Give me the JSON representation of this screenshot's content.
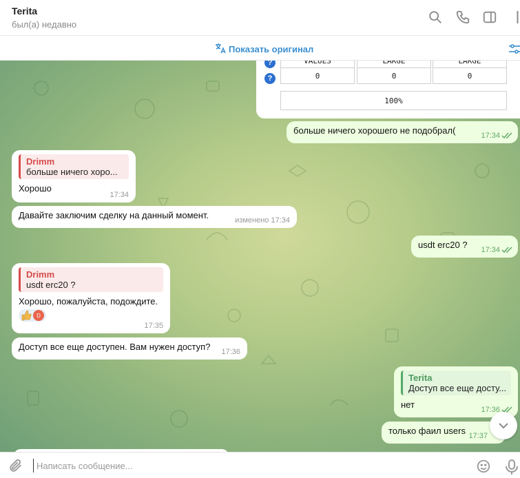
{
  "header": {
    "contact_name": "Terita",
    "status": "был(а) недавно",
    "icons": [
      "search-icon",
      "phone-icon",
      "sidebar-toggle-icon",
      "more-icon"
    ]
  },
  "translate_bar": {
    "label": "Показать оригинал",
    "icons": [
      "translate-icon",
      "filter-icon"
    ]
  },
  "table_card": {
    "row_values": [
      "0",
      "0",
      "0"
    ],
    "progress_label": "100%",
    "partial_header": [
      "VALUES",
      "LARGE",
      "LARGE"
    ]
  },
  "messages": [
    {
      "id": "m1",
      "dir": "out",
      "text": "больше ничего хорошего не подобрал(",
      "time": "17:34"
    },
    {
      "id": "m2",
      "dir": "in",
      "quote_name": "Drimm",
      "quote_text": "больше ничего хоро...",
      "text": "Хорошо",
      "time": "17:34"
    },
    {
      "id": "m3",
      "dir": "in",
      "text": "Давайте заключим сделку на данный момент.",
      "time": "изменено 17:34"
    },
    {
      "id": "m4",
      "dir": "out",
      "text": "usdt erc20 ?",
      "time": "17:34"
    },
    {
      "id": "m5",
      "dir": "in",
      "quote_name": "Drimm",
      "quote_text": "usdt erc20 ?",
      "text": "Хорошо, пожалуйста, подождите.",
      "time": "17:35",
      "reaction_avatar": "D"
    },
    {
      "id": "m6",
      "dir": "in",
      "text": "Доступ все еще доступен. Вам нужен доступ?",
      "time": "17:36"
    },
    {
      "id": "m7",
      "dir": "out",
      "quote_name": "Terita",
      "quote_text": "Доступ все еще досту...",
      "text": "нет",
      "time": "17:36"
    },
    {
      "id": "m8",
      "dir": "out",
      "text": "только фаил users",
      "time": "17:37"
    }
  ],
  "input": {
    "placeholder": "Написать сообщение..."
  },
  "colors": {
    "accent": "#3a8fd0",
    "outgoing_bubble": "#eefee0",
    "quote_red": "#d64b4b",
    "quote_green": "#4e9a5e"
  }
}
